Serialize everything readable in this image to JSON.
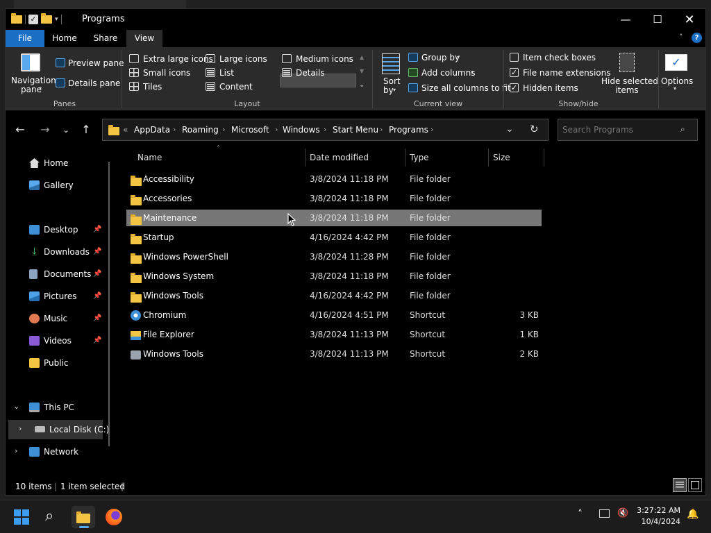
{
  "window": {
    "title": "Programs"
  },
  "ribbon_tabs": [
    "File",
    "Home",
    "Share",
    "View"
  ],
  "ribbon": {
    "panes": {
      "navigation_pane": [
        "Navigation",
        "pane"
      ],
      "preview_pane": "Preview pane",
      "details_pane": "Details pane",
      "group": "Panes"
    },
    "layout": {
      "options": [
        "Extra large icons",
        "Large icons",
        "Medium icons",
        "Small icons",
        "List",
        "Details",
        "Tiles",
        "Content"
      ],
      "selected": "Details",
      "group": "Layout"
    },
    "current_view": {
      "sort_by": [
        "Sort",
        "by"
      ],
      "group_by": "Group by",
      "add_columns": "Add columns",
      "size_all_columns": "Size all columns to fit",
      "group": "Current view"
    },
    "show_hide": {
      "item_check_boxes": {
        "label": "Item check boxes",
        "checked": false
      },
      "file_name_extensions": {
        "label": "File name extensions",
        "checked": true
      },
      "hidden_items": {
        "label": "Hidden items",
        "checked": true
      },
      "hide_selected": [
        "Hide selected",
        "items"
      ],
      "group": "Show/hide"
    },
    "options": "Options"
  },
  "address": {
    "overflow": "«",
    "crumbs": [
      "AppData",
      "Roaming",
      "Microsoft",
      "Windows",
      "Start Menu",
      "Programs"
    ],
    "search_placeholder": "Search Programs"
  },
  "nav_pane": {
    "top": [
      "Home",
      "Gallery"
    ],
    "pinned": [
      "Desktop",
      "Downloads",
      "Documents",
      "Pictures",
      "Music",
      "Videos"
    ],
    "other": [
      "Public"
    ],
    "this_pc": "This PC",
    "local_disk": "Local Disk (C:)",
    "network": "Network"
  },
  "columns": [
    "Name",
    "Date modified",
    "Type",
    "Size"
  ],
  "files": [
    {
      "name": "Accessibility",
      "date": "3/8/2024 11:18 PM",
      "type": "File folder",
      "size": "",
      "icon": "folder"
    },
    {
      "name": "Accessories",
      "date": "3/8/2024 11:18 PM",
      "type": "File folder",
      "size": "",
      "icon": "folder"
    },
    {
      "name": "Maintenance",
      "date": "3/8/2024 11:18 PM",
      "type": "File folder",
      "size": "",
      "icon": "folder",
      "selected": true
    },
    {
      "name": "Startup",
      "date": "4/16/2024 4:42 PM",
      "type": "File folder",
      "size": "",
      "icon": "folder"
    },
    {
      "name": "Windows PowerShell",
      "date": "3/8/2024 11:28 PM",
      "type": "File folder",
      "size": "",
      "icon": "folder"
    },
    {
      "name": "Windows System",
      "date": "3/8/2024 11:18 PM",
      "type": "File folder",
      "size": "",
      "icon": "folder"
    },
    {
      "name": "Windows Tools",
      "date": "4/16/2024 4:42 PM",
      "type": "File folder",
      "size": "",
      "icon": "folder"
    },
    {
      "name": "Chromium",
      "date": "4/16/2024 4:51 PM",
      "type": "Shortcut",
      "size": "3 KB",
      "icon": "chromium"
    },
    {
      "name": "File Explorer",
      "date": "3/8/2024 11:13 PM",
      "type": "Shortcut",
      "size": "1 KB",
      "icon": "explorer"
    },
    {
      "name": "Windows Tools",
      "date": "3/8/2024 11:13 PM",
      "type": "Shortcut",
      "size": "2 KB",
      "icon": "tools"
    }
  ],
  "status": {
    "items": "10 items",
    "selected": "1 item selected"
  },
  "taskbar": {
    "time": "3:27:22 AM",
    "date": "10/4/2024"
  },
  "colors": {
    "accent": "#1a6fc4",
    "folder": "#f4c542",
    "selection": "#777777"
  }
}
